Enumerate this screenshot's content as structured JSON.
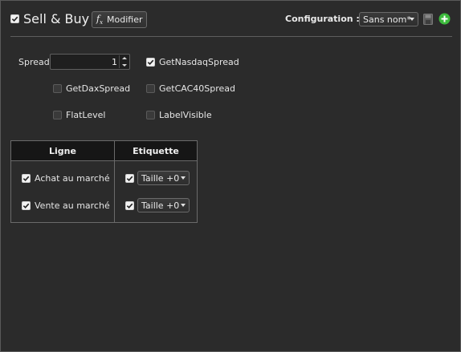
{
  "header": {
    "enabled": true,
    "title": "Sell & Buy",
    "modify_icon": "fx-icon",
    "modify_label": "Modifier",
    "config_label": "Configuration :",
    "config_value": "Sans nom*",
    "save_icon": "save-icon",
    "add_icon": "add-icon",
    "accent_add": "#3cba3c"
  },
  "params": {
    "spread_label": "Spread",
    "spread_value": "1",
    "options": [
      {
        "label": "GetNasdaqSpread",
        "checked": true
      },
      {
        "label": "GetDaxSpread",
        "checked": false
      },
      {
        "label": "GetCAC40Spread",
        "checked": false
      },
      {
        "label": "FlatLevel",
        "checked": false
      },
      {
        "label": "LabelVisible",
        "checked": false
      }
    ]
  },
  "table": {
    "col_line": "Ligne",
    "col_label": "Etiquette",
    "rows": [
      {
        "line": "Achat au marché",
        "line_checked": true,
        "label_checked": true,
        "label_value": "Taille +0"
      },
      {
        "line": "Vente au marché",
        "line_checked": true,
        "label_checked": true,
        "label_value": "Taille +0"
      }
    ]
  }
}
